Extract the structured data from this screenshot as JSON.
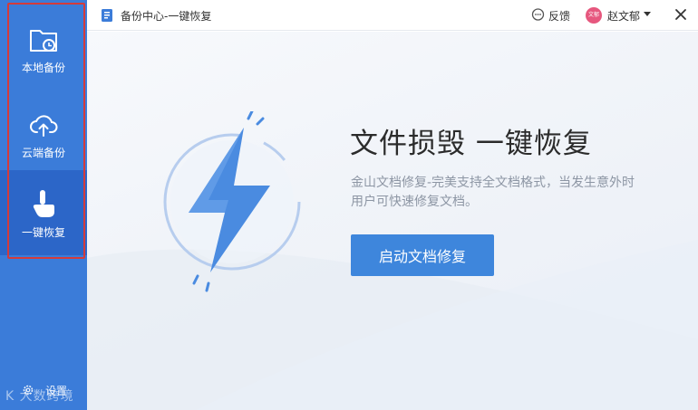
{
  "window": {
    "title": "备份中心-一键恢复",
    "feedback_label": "反馈",
    "user_name": "赵文郁",
    "avatar_text": "文郁"
  },
  "sidebar": {
    "items": [
      {
        "label": "本地备份",
        "icon": "local-folder-clock-icon",
        "active": false
      },
      {
        "label": "云端备份",
        "icon": "cloud-upload-icon",
        "active": false
      },
      {
        "label": "一键恢复",
        "icon": "hand-pointer-icon",
        "active": true
      }
    ],
    "settings_label": "设置",
    "watermark": "K 大数跨境"
  },
  "main": {
    "headline": "文件损毁  一键恢复",
    "description": "金山文档修复-完美支持全文档格式，当发生意外时用户可快速修复文档。",
    "cta_label": "启动文档修复",
    "illustration": "lightning-bolt-icon"
  },
  "colors": {
    "sidebar_bg": "#3b7cd9",
    "sidebar_active": "#2c66c8",
    "accent": "#3e86dc",
    "highlight_box": "#d43b3b",
    "avatar": "#e6577e"
  }
}
